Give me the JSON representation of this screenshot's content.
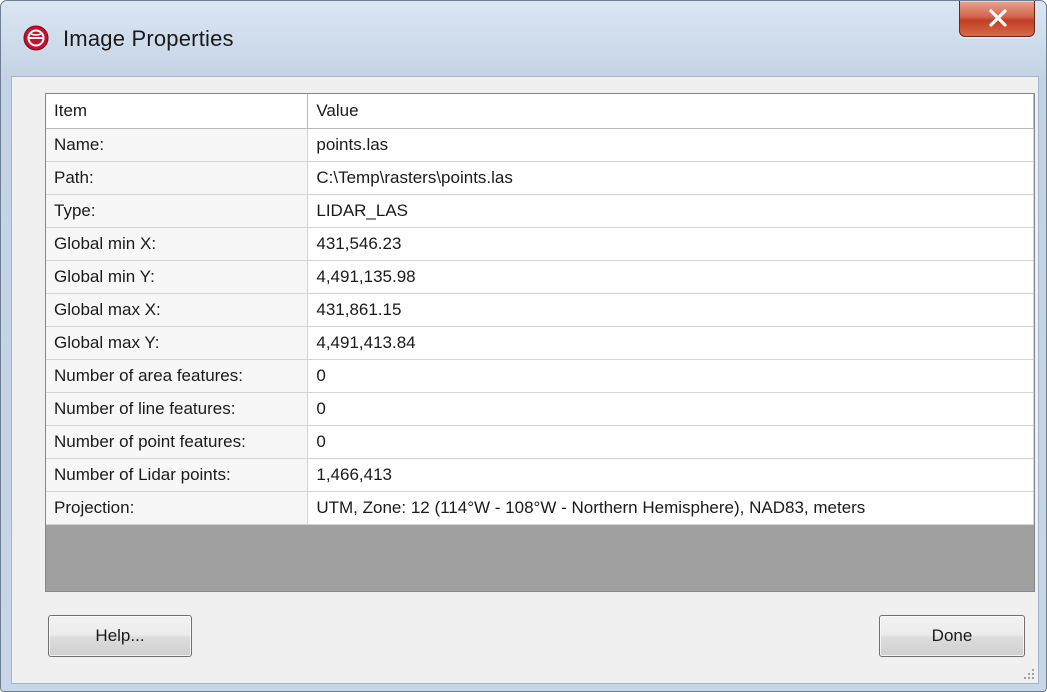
{
  "window": {
    "title": "Image Properties",
    "close_icon": "close-x-icon",
    "app_icon": "globe-app-icon"
  },
  "table": {
    "headers": {
      "item": "Item",
      "value": "Value"
    },
    "rows": [
      {
        "item": "Name:",
        "value": "points.las"
      },
      {
        "item": "Path:",
        "value": "C:\\Temp\\rasters\\points.las"
      },
      {
        "item": "Type:",
        "value": "LIDAR_LAS"
      },
      {
        "item": "Global min X:",
        "value": "431,546.23"
      },
      {
        "item": "Global min Y:",
        "value": "4,491,135.98"
      },
      {
        "item": "Global max X:",
        "value": "431,861.15"
      },
      {
        "item": "Global max Y:",
        "value": "4,491,413.84"
      },
      {
        "item": "Number of area features:",
        "value": "0"
      },
      {
        "item": "Number of line features:",
        "value": "0"
      },
      {
        "item": "Number of point features:",
        "value": "0"
      },
      {
        "item": "Number of Lidar points:",
        "value": "1,466,413"
      },
      {
        "item": "Projection:",
        "value": "UTM, Zone: 12 (114°W - 108°W - Northern Hemisphere), NAD83, meters"
      }
    ]
  },
  "buttons": {
    "help_label": "Help...",
    "done_label": "Done"
  },
  "colors": {
    "close_button": "#c94a2e",
    "app_icon": "#c8102e"
  }
}
